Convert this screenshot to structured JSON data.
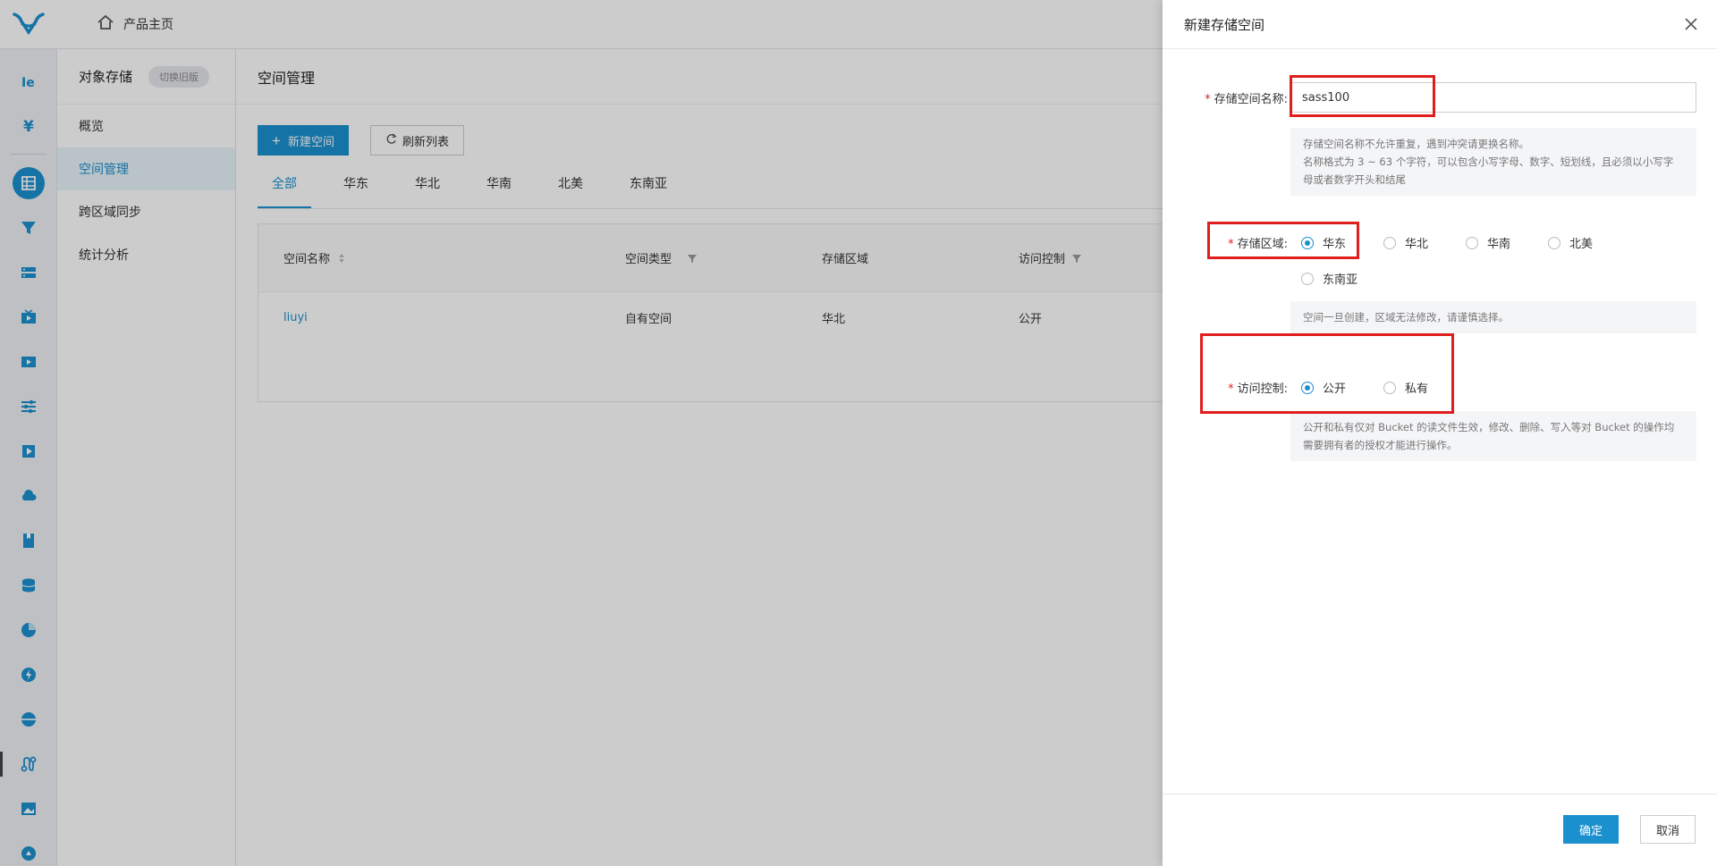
{
  "topbar": {
    "home_label": "产品主页"
  },
  "rail": {
    "icons": [
      "realtime-icon",
      "yuan-icon",
      "grid-storage-icon",
      "funnel-icon",
      "server-icon",
      "video-tv-icon",
      "film-icon",
      "sliders-icon",
      "play-icon",
      "cloud-icon",
      "bookmark-icon",
      "database-icon",
      "chart-icon",
      "lightning-icon",
      "globe-icon",
      "route-icon",
      "image-icon",
      "app-icon"
    ]
  },
  "subnav": {
    "title": "对象存储",
    "switch_label": "切换旧版",
    "items": [
      {
        "label": "概览"
      },
      {
        "label": "空间管理"
      },
      {
        "label": "跨区域同步"
      },
      {
        "label": "统计分析"
      }
    ]
  },
  "main": {
    "title": "空间管理",
    "new_button": "新建空间",
    "refresh_button": "刷新列表",
    "tabs": [
      {
        "label": "全部"
      },
      {
        "label": "华东"
      },
      {
        "label": "华北"
      },
      {
        "label": "华南"
      },
      {
        "label": "北美"
      },
      {
        "label": "东南亚"
      }
    ],
    "table": {
      "headers": [
        "空间名称",
        "空间类型",
        "存储区域",
        "访问控制"
      ],
      "rows": [
        [
          "liuyi",
          "自有空间",
          "华北",
          "公开"
        ]
      ]
    }
  },
  "drawer": {
    "title": "新建存储空间",
    "name_label": "存储空间名称:",
    "name_value": "sass100",
    "name_hint_line1": "存储空间名称不允许重复，遇到冲突请更换名称。",
    "name_hint_line2": "名称格式为 3 ~ 63 个字符，可以包含小写字母、数字、短划线，且必须以小写字",
    "name_hint_line3": "母或者数字开头和结尾",
    "region_label": "存储区域:",
    "regions": [
      "华东",
      "华北",
      "华南",
      "北美",
      "东南亚"
    ],
    "region_selected": "华东",
    "region_hint": "空间一旦创建，区域无法修改，请谨慎选择。",
    "access_label": "访问控制:",
    "access_options": [
      "公开",
      "私有"
    ],
    "access_selected": "公开",
    "access_hint_line1": "公开和私有仅对 Bucket 的读文件生效，修改、删除、写入等对 Bucket 的操作均",
    "access_hint_line2": "需要拥有者的授权才能进行操作。",
    "ok_button": "确定",
    "cancel_button": "取消"
  },
  "colors": {
    "accent": "#1b90cf",
    "annotation": "#e01e1e",
    "required": "#e02020"
  }
}
